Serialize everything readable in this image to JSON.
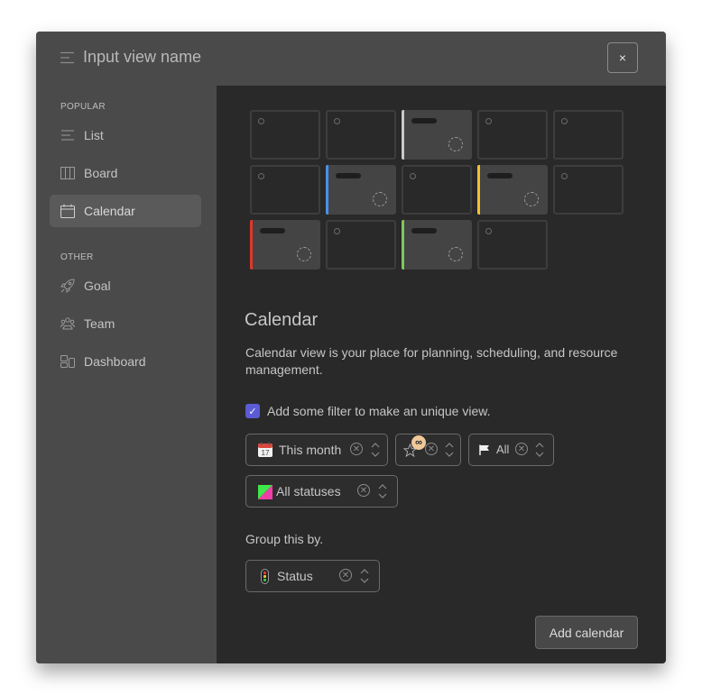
{
  "header": {
    "title": "Input view name",
    "title_icon": "menu-lines-icon",
    "close_label": "×"
  },
  "sidebar": {
    "sections": [
      {
        "label": "POPULAR",
        "items": [
          {
            "label": "List",
            "icon": "list-icon",
            "active": false
          },
          {
            "label": "Board",
            "icon": "board-columns-icon",
            "active": false
          },
          {
            "label": "Calendar",
            "icon": "calendar-icon",
            "active": true
          }
        ]
      },
      {
        "label": "OTHER",
        "items": [
          {
            "label": "Goal",
            "icon": "rocket-icon",
            "active": false
          },
          {
            "label": "Team",
            "icon": "team-icon",
            "active": false
          },
          {
            "label": "Dashboard",
            "icon": "dashboard-icon",
            "active": false
          }
        ]
      }
    ]
  },
  "preview": {
    "rows": [
      [
        {
          "event": false
        },
        {
          "event": false
        },
        {
          "event": true,
          "color": "#c8c8d0"
        },
        {
          "event": false
        },
        {
          "event": false
        }
      ],
      [
        {
          "event": false
        },
        {
          "event": true,
          "color": "#4a8fe8"
        },
        {
          "event": false
        },
        {
          "event": true,
          "color": "#f5c02e"
        },
        {
          "event": false
        }
      ],
      [
        {
          "event": true,
          "color": "#e0372a"
        },
        {
          "event": false
        },
        {
          "event": true,
          "color": "#7cc95a"
        },
        {
          "event": false
        }
      ]
    ]
  },
  "main": {
    "title": "Calendar",
    "description": "Calendar view is your place for planning, scheduling, and resource management.",
    "filter_checkbox": {
      "label": "Add some filter to make an unique view.",
      "checked": true
    },
    "filters": [
      {
        "label": "This month",
        "icon": "calendar-emoji-icon"
      },
      {
        "label": "",
        "icon": "star-icon",
        "badge": "∞"
      },
      {
        "label": "All",
        "icon": "flag-icon"
      },
      {
        "label": "All statuses",
        "icon": "status-swatch-icon"
      }
    ],
    "group_label": "Group this by.",
    "group_by": {
      "label": "Status",
      "icon": "traffic-light-icon"
    },
    "submit_label": "Add calendar"
  },
  "colors": {
    "accent": "#5b5bd6",
    "status_green": "#3ee84a",
    "status_pink": "#f03ea8"
  }
}
